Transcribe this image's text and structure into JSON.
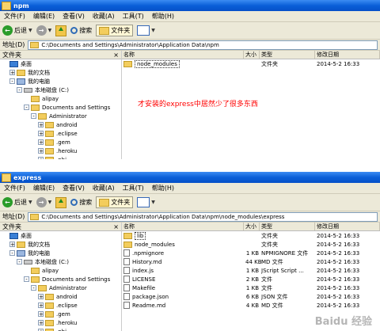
{
  "colors": {
    "annotation": "#ff0000",
    "titlebar": "#0a5fd8"
  },
  "menu": [
    "文件(F)",
    "编辑(E)",
    "查看(V)",
    "收藏(A)",
    "工具(T)",
    "帮助(H)"
  ],
  "toolbar": {
    "back": "后退",
    "search": "搜索",
    "folders": "文件夹"
  },
  "address_label": "地址(D)",
  "pane_title": "文件夹",
  "columns": {
    "name": "名称",
    "size": "大小",
    "type": "类型",
    "date": "修改日期"
  },
  "window1": {
    "title": "npm",
    "address": "C:\\Documents and Settings\\Administrator\\Application Data\\npm",
    "tree": [
      {
        "label": "桌面",
        "icon": "desktop",
        "depth": 0,
        "exp": ""
      },
      {
        "label": "我的文档",
        "icon": "folder",
        "depth": 1,
        "exp": "+"
      },
      {
        "label": "我的电脑",
        "icon": "computer",
        "depth": 1,
        "exp": "-"
      },
      {
        "label": "本地磁盘 (C:)",
        "icon": "drive",
        "depth": 2,
        "exp": "-"
      },
      {
        "label": "alipay",
        "icon": "folder",
        "depth": 3,
        "exp": ""
      },
      {
        "label": "Documents and Settings",
        "icon": "folder",
        "depth": 3,
        "exp": "-"
      },
      {
        "label": "Administrator",
        "icon": "folder",
        "depth": 4,
        "exp": "-"
      },
      {
        "label": "android",
        "icon": "folder",
        "depth": 5,
        "exp": "+"
      },
      {
        "label": ".eclipse",
        "icon": "folder",
        "depth": 5,
        "exp": "+"
      },
      {
        "label": ".gem",
        "icon": "folder",
        "depth": 5,
        "exp": "+"
      },
      {
        "label": ".heroku",
        "icon": "folder",
        "depth": 5,
        "exp": "+"
      },
      {
        "label": ".nbi",
        "icon": "folder",
        "depth": 5,
        "exp": "+"
      }
    ],
    "files": [
      {
        "name": "node_modules",
        "size": "",
        "type": "文件夹",
        "date": "2014-5-2 16:33",
        "icon": "folder",
        "selected": true
      }
    ],
    "annotation": "才安装的express中居然少了很多东西"
  },
  "window2": {
    "title": "express",
    "address": "C:\\Documents and Settings\\Administrator\\Application Data\\npm\\node_modules\\express",
    "tree": [
      {
        "label": "桌面",
        "icon": "desktop",
        "depth": 0,
        "exp": ""
      },
      {
        "label": "我的文档",
        "icon": "folder",
        "depth": 1,
        "exp": "+"
      },
      {
        "label": "我的电脑",
        "icon": "computer",
        "depth": 1,
        "exp": "-"
      },
      {
        "label": "本地磁盘 (C:)",
        "icon": "drive",
        "depth": 2,
        "exp": "-"
      },
      {
        "label": "alipay",
        "icon": "folder",
        "depth": 3,
        "exp": ""
      },
      {
        "label": "Documents and Settings",
        "icon": "folder",
        "depth": 3,
        "exp": "-"
      },
      {
        "label": "Administrator",
        "icon": "folder",
        "depth": 4,
        "exp": "-"
      },
      {
        "label": "android",
        "icon": "folder",
        "depth": 5,
        "exp": "+"
      },
      {
        "label": ".eclipse",
        "icon": "folder",
        "depth": 5,
        "exp": "+"
      },
      {
        "label": ".gem",
        "icon": "folder",
        "depth": 5,
        "exp": "+"
      },
      {
        "label": ".heroku",
        "icon": "folder",
        "depth": 5,
        "exp": "+"
      },
      {
        "label": ".nbi",
        "icon": "folder",
        "depth": 5,
        "exp": "+"
      }
    ],
    "files": [
      {
        "name": "lib",
        "size": "",
        "type": "文件夹",
        "date": "2014-5-2 16:33",
        "icon": "folder",
        "selected": true
      },
      {
        "name": "node_modules",
        "size": "",
        "type": "文件夹",
        "date": "2014-5-2 16:33",
        "icon": "folder",
        "selected": false
      },
      {
        "name": ".npmignore",
        "size": "1 KB",
        "type": "NPMIGNORE 文件",
        "date": "2014-5-2 16:33",
        "icon": "file",
        "selected": false
      },
      {
        "name": "History.md",
        "size": "44 KB",
        "type": "MD 文件",
        "date": "2014-5-2 16:33",
        "icon": "file",
        "selected": false
      },
      {
        "name": "index.js",
        "size": "1 KB",
        "type": "JScript Script ...",
        "date": "2014-5-2 16:33",
        "icon": "file",
        "selected": false
      },
      {
        "name": "LICENSE",
        "size": "2 KB",
        "type": "文件",
        "date": "2014-5-2 16:33",
        "icon": "file",
        "selected": false
      },
      {
        "name": "Makefile",
        "size": "1 KB",
        "type": "文件",
        "date": "2014-5-2 16:33",
        "icon": "file",
        "selected": false
      },
      {
        "name": "package.json",
        "size": "6 KB",
        "type": "JSON 文件",
        "date": "2014-5-2 16:33",
        "icon": "file",
        "selected": false
      },
      {
        "name": "Readme.md",
        "size": "4 KB",
        "type": "MD 文件",
        "date": "2014-5-2 16:33",
        "icon": "file",
        "selected": false
      }
    ]
  },
  "watermark": "Baidu 经验"
}
